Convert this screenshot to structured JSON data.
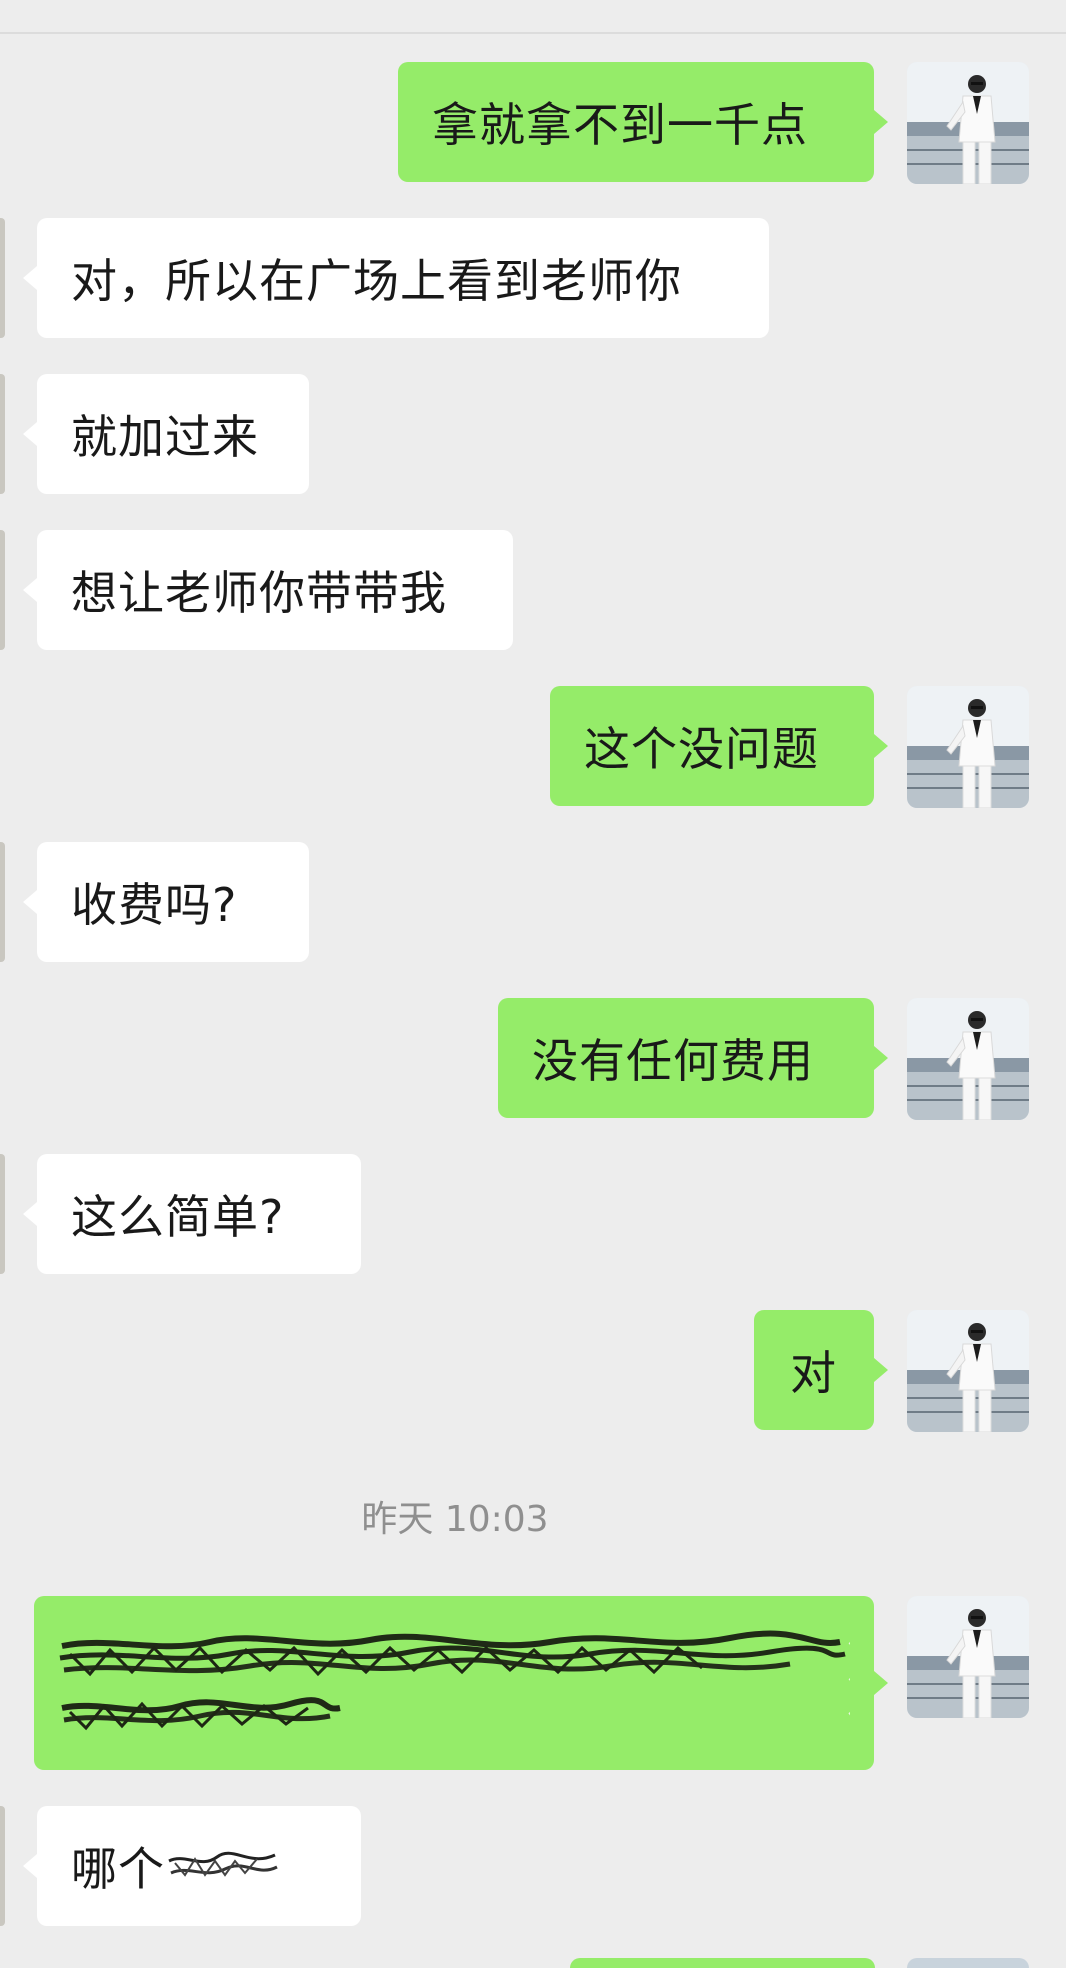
{
  "chat": {
    "messages": [
      {
        "side": "out",
        "text": "拿就拿不到一千点"
      },
      {
        "side": "in",
        "text": "对，所以在广场上看到老师你"
      },
      {
        "side": "in",
        "text": "就加过来"
      },
      {
        "side": "in",
        "text": "想让老师你带带我"
      },
      {
        "side": "out",
        "text": "这个没问题"
      },
      {
        "side": "in",
        "text": "收费吗?"
      },
      {
        "side": "out",
        "text": "没有任何费用"
      },
      {
        "side": "in",
        "text": "这么简单?"
      },
      {
        "side": "out",
        "text": "对"
      },
      {
        "side": "out",
        "text": "",
        "redacted": true
      },
      {
        "side": "in",
        "text": "哪个"
      }
    ],
    "timestamp": "昨天 10:03"
  },
  "icons": {
    "self_avatar": "avatar-man-in-white-suit"
  },
  "colors": {
    "background": "#ededed",
    "outgoing_bubble": "#95ec69",
    "incoming_bubble": "#ffffff",
    "timestamp_text": "#8f8f8f"
  }
}
